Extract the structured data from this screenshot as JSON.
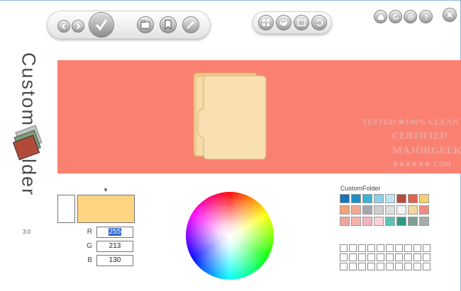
{
  "app": {
    "title": "Custom Folder",
    "version": "3.0"
  },
  "toolbar": {
    "nav_buttons": [
      "back-arrow-icon",
      "forward-arrow-icon"
    ],
    "apply_icon": "checkmark-icon",
    "tool_buttons": [
      "folder-icon",
      "bookmark-icon",
      "wand-icon"
    ],
    "mid_buttons": [
      "grid-icon",
      "palette-icon",
      "image-icon",
      "undo-icon"
    ],
    "right_buttons": [
      "home-icon",
      "refresh-icon",
      "gear-icon",
      "help-icon"
    ],
    "close_icon": "close-icon"
  },
  "preview": {
    "background": "#fa8072",
    "folder_color": "#f7dca9"
  },
  "color": {
    "current": "#ffd582",
    "r_label": "R",
    "g_label": "G",
    "b_label": "B",
    "r": "255",
    "g": "213",
    "b": "130"
  },
  "palette": {
    "title": "CustomFolder",
    "colors": [
      "#1a72b8",
      "#1d8fc8",
      "#3bb1d6",
      "#8bd0e8",
      "#bfe6f0",
      "#b64c3e",
      "#e06452",
      "#f6cf72",
      "#f4a478",
      "#f3a992",
      "#a3a7ad",
      "#cfcfcf",
      "#dedede",
      "#f2f2f2",
      "#f6d79c",
      "#f08d83",
      "#f0a5a0",
      "#f7b2ad",
      "#f3b3bd",
      "#fbd3d7",
      "#5ec2b3",
      "#2f9a84",
      "#7f9f95",
      "#a7acad"
    ],
    "empty_rows": 3,
    "empty_cols": 10
  },
  "watermark": {
    "line1": "TESTED ★100% CLEAN",
    "line2": "CERTIFIED",
    "line3": "MAJORGEEKS",
    "line4": "★★★★★★ .COM"
  }
}
